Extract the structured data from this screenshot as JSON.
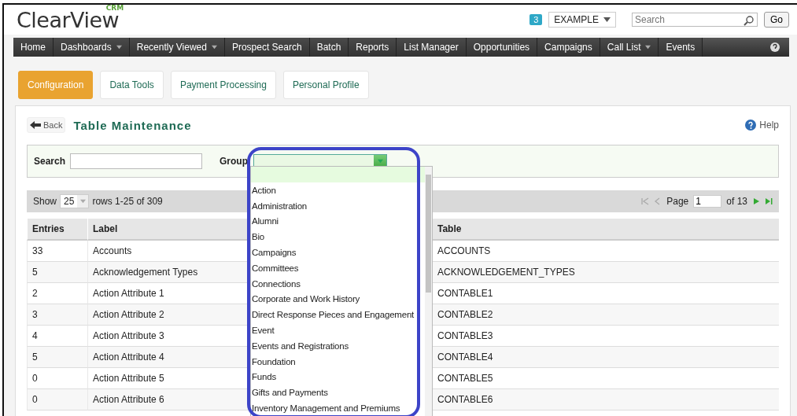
{
  "header": {
    "logo": {
      "name": "ClearView",
      "tag": "CRM"
    },
    "badge": "3",
    "account": "EXAMPLE",
    "search": {
      "placeholder": "Search"
    },
    "go": "Go"
  },
  "nav": [
    {
      "label": "Home",
      "has_menu": false
    },
    {
      "label": "Dashboards",
      "has_menu": true
    },
    {
      "label": "Recently Viewed",
      "has_menu": true
    },
    {
      "label": "Prospect Search",
      "has_menu": false
    },
    {
      "label": "Batch",
      "has_menu": false
    },
    {
      "label": "Reports",
      "has_menu": false
    },
    {
      "label": "List Manager",
      "has_menu": false
    },
    {
      "label": "Opportunities",
      "has_menu": false
    },
    {
      "label": "Campaigns",
      "has_menu": false
    },
    {
      "label": "Call List",
      "has_menu": true
    },
    {
      "label": "Events",
      "has_menu": false
    }
  ],
  "tabs": [
    {
      "label": "Configuration",
      "selected": true
    },
    {
      "label": "Data Tools",
      "selected": false
    },
    {
      "label": "Payment Processing",
      "selected": false
    },
    {
      "label": "Personal Profile",
      "selected": false
    }
  ],
  "page": {
    "back": "Back",
    "title": "Table Maintenance",
    "help": "Help"
  },
  "filters": {
    "search_label": "Search",
    "group_label": "Group",
    "group_options": [
      "Action",
      "Administration",
      "Alumni",
      "Bio",
      "Campaigns",
      "Committees",
      "Connections",
      "Corporate and Work History",
      "Direct Response Pieces and Engagement",
      "Event",
      "Events and Registrations",
      "Foundation",
      "Funds",
      "Gifts and Payments",
      "Inventory Management and Premiums"
    ]
  },
  "pager": {
    "show_label": "Show",
    "page_size": "25",
    "rows_info": "rows 1-25 of 309",
    "page_label": "Page",
    "page": "1",
    "of_pages": "of 13"
  },
  "table": {
    "columns": [
      "Entries",
      "Label",
      "Table"
    ],
    "rows": [
      [
        "33",
        "Accounts",
        "ACCOUNTS"
      ],
      [
        "5",
        "Acknowledgement Types",
        "ACKNOWLEDGEMENT_TYPES"
      ],
      [
        "2",
        "Action Attribute 1",
        "CONTABLE1"
      ],
      [
        "3",
        "Action Attribute 2",
        "CONTABLE2"
      ],
      [
        "4",
        "Action Attribute 3",
        "CONTABLE3"
      ],
      [
        "5",
        "Action Attribute 4",
        "CONTABLE4"
      ],
      [
        "0",
        "Action Attribute 5",
        "CONTABLE5"
      ],
      [
        "0",
        "Action Attribute 6",
        "CONTABLE6"
      ]
    ]
  }
}
